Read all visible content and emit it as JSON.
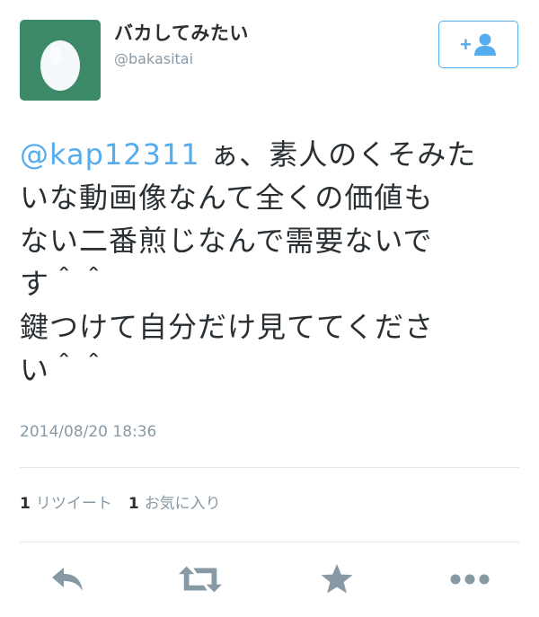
{
  "user": {
    "display_name": "バカしてみたい",
    "username": "@bakasitai"
  },
  "follow_button": {
    "icon": "add-user-icon",
    "label": "+"
  },
  "tweet": {
    "mention": "@kap12311",
    "lines": [
      " ぁ、素人のくそみた",
      "いな動画像なんて全くの価値も",
      "ない二番煎じなんで需要ないで",
      "す＾＾",
      "鍵つけて自分だけ見ててくださ",
      "い＾＾"
    ],
    "timestamp": "2014/08/20 18:36"
  },
  "stats": {
    "retweets_count": "1",
    "retweets_label": "リツイート",
    "favorites_count": "1",
    "favorites_label": "お気に入り"
  },
  "actions": [
    {
      "name": "reply",
      "icon": "reply-icon"
    },
    {
      "name": "retweet",
      "icon": "retweet-icon"
    },
    {
      "name": "favorite",
      "icon": "star-icon"
    },
    {
      "name": "more",
      "icon": "more-icon"
    }
  ],
  "colors": {
    "accent": "#55acee",
    "avatar_bg": "#3c8a67",
    "muted": "#8899a6",
    "icon": "#8899a6",
    "text": "#292f33"
  }
}
